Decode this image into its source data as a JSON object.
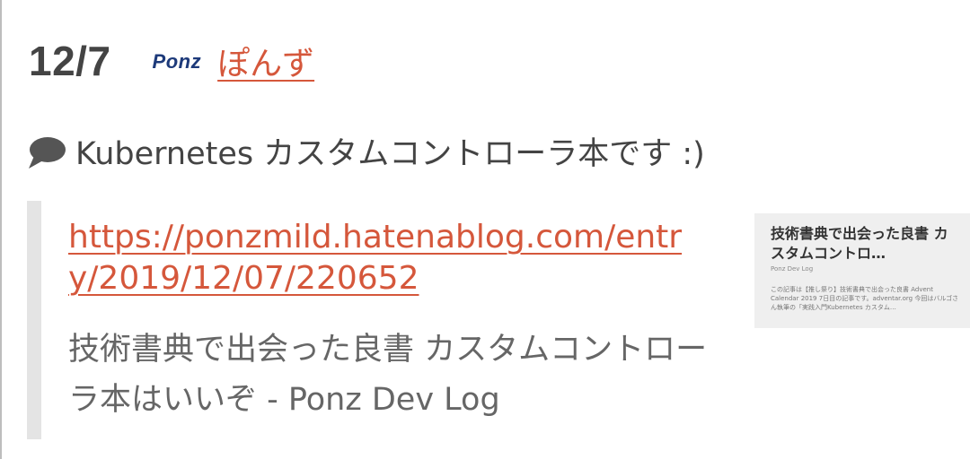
{
  "header": {
    "date": "12/7",
    "author_icon_text": "Ponz",
    "author_name": "ぽんず"
  },
  "entry": {
    "comment_icon": "speech-bubble-icon",
    "comment": "Kubernetes カスタムコントローラ本です :)"
  },
  "link_card": {
    "url": "https://ponzmild.hatenablog.com/entry/2019/12/07/220652",
    "title": "技術書典で出会った良書 カスタムコントローラ本はいいぞ - Ponz Dev Log",
    "thumbnail": {
      "title": "技術書典で出会った良書 カスタムコントロ…",
      "blog_name": "Ponz Dev Log",
      "excerpt": "この記事は【推し祭り】技術書典で出会った良書 Advent Calendar 2019 7日目の記事です。adventar.org 今回はバルゴさん執筆の「実践入門Kubernetes カスタム…"
    }
  },
  "colors": {
    "accent_link": "#d5573b",
    "author_icon": "#1d3a7a",
    "text": "#444444",
    "quote_bar": "#e4e4e4"
  }
}
